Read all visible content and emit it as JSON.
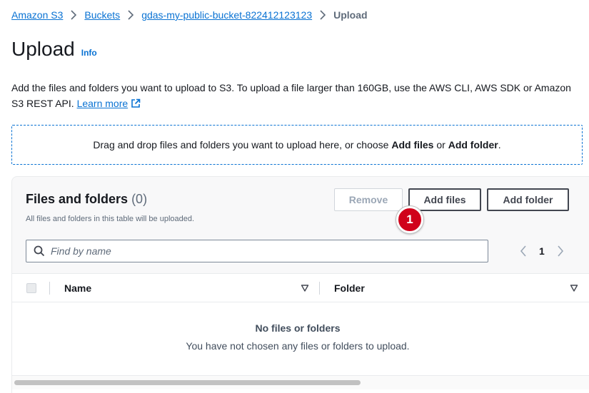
{
  "breadcrumb": {
    "items": [
      "Amazon S3",
      "Buckets",
      "gdas-my-public-bucket-822412123123"
    ],
    "current": "Upload"
  },
  "page": {
    "title": "Upload",
    "info": "Info",
    "description": "Add the files and folders you want to upload to S3. To upload a file larger than 160GB, use the AWS CLI, AWS SDK or Amazon S3 REST API.",
    "learn_more": "Learn more"
  },
  "dropzone": {
    "text_before": "Drag and drop files and folders you want to upload here, or choose ",
    "add_files": "Add files",
    "or": " or ",
    "add_folder": "Add folder",
    "period": "."
  },
  "files_panel": {
    "title": "Files and folders",
    "count": "(0)",
    "subtitle": "All files and folders in this table will be uploaded.",
    "remove_label": "Remove",
    "add_files_label": "Add files",
    "add_folder_label": "Add folder",
    "callout_number": "1",
    "search_placeholder": "Find by name",
    "page_number": "1",
    "columns": [
      "Name",
      "Folder"
    ],
    "empty_title": "No files or folders",
    "empty_subtitle": "You have not chosen any files or folders to upload."
  },
  "colors": {
    "link": "#0972d3",
    "text": "#16191f",
    "callout": "#d0021b"
  }
}
